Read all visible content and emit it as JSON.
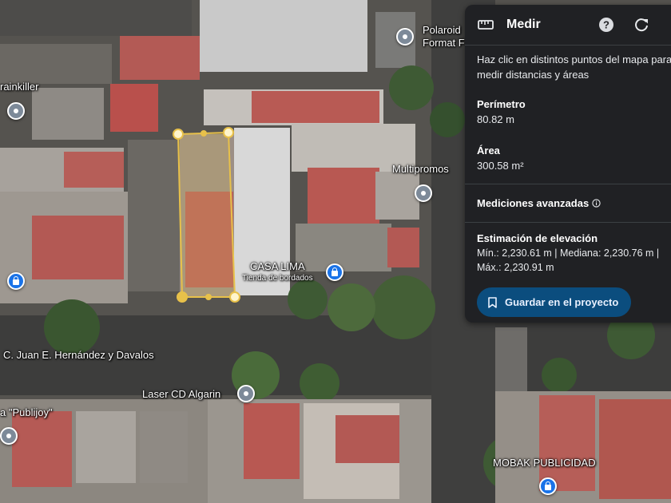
{
  "map": {
    "labels": {
      "polaroid_line1": "Polaroid",
      "polaroid_line2": "Format F",
      "painkiller": "rainkiller",
      "multipromos": "Multipromos",
      "casa_lima": "CASA LIMA",
      "casa_lima_sub": "Tienda de bordados",
      "street": "C. Juan E. Hernández y Davalos",
      "laser_cd": "Laser CD Algarin",
      "publijoy": "a \"Publijoy\"",
      "mobak": "MOBAK PUBLICIDAD"
    },
    "colors": {
      "measure_line": "#e8c14a",
      "panel_bg": "#202124",
      "button_bg": "#0b4d7e"
    }
  },
  "panel": {
    "title": "Medir",
    "description": "Haz clic en distintos puntos del mapa para medir distancias y áreas",
    "perimeter_label": "Perímetro",
    "perimeter_value": "80.82 m",
    "area_label": "Área",
    "area_value": "300.58 m²",
    "advanced_label": "Mediciones avanzadas",
    "elevation_label": "Estimación de elevación",
    "elevation_line1": "Mín.: 2,230.61 m | Mediana: 2,230.76 m |",
    "elevation_line2": "Máx.: 2,230.91 m",
    "save_label": "Guardar en el proyecto"
  }
}
